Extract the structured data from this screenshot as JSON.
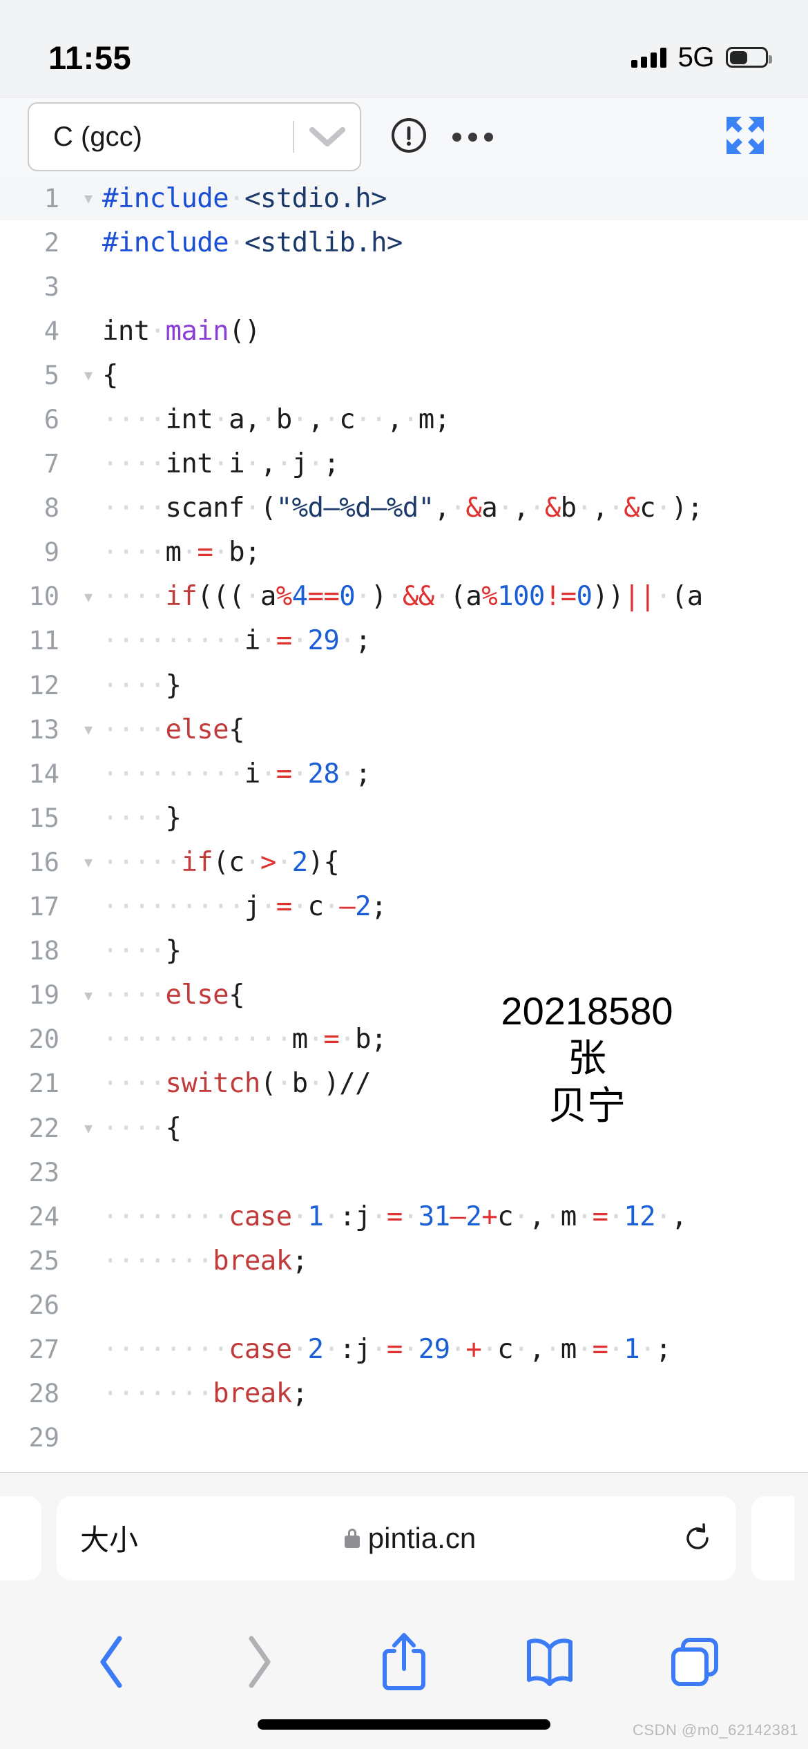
{
  "status_bar": {
    "time": "11:55",
    "network_label": "5G",
    "signal_icon": "signal-bars-icon",
    "battery_icon": "battery-icon",
    "battery_level_percent": 46
  },
  "editor_toolbar": {
    "language_value": "C (gcc)",
    "chevron_icon": "chevron-down-icon",
    "warning_icon": "exclamation-circle-icon",
    "more_icon": "ellipsis-icon",
    "expand_icon": "fullscreen-expand-icon",
    "accent_color": "#3b82f6"
  },
  "code": {
    "language": "C (gcc)",
    "lines": [
      {
        "n": "1",
        "fold": true,
        "highlight": true,
        "tokens": [
          {
            "t": "#include",
            "c": "t-pp"
          },
          {
            "t": "·",
            "c": "ws"
          },
          {
            "t": "<stdio.h>",
            "c": "t-hdr"
          }
        ]
      },
      {
        "n": "2",
        "fold": false,
        "highlight": false,
        "tokens": [
          {
            "t": "#include",
            "c": "t-pp"
          },
          {
            "t": "·",
            "c": "ws"
          },
          {
            "t": "<stdlib.h>",
            "c": "t-hdr"
          }
        ]
      },
      {
        "n": "3",
        "fold": false,
        "highlight": false,
        "tokens": []
      },
      {
        "n": "4",
        "fold": false,
        "highlight": false,
        "tokens": [
          {
            "t": "int",
            "c": "t-pun"
          },
          {
            "t": "·",
            "c": "ws"
          },
          {
            "t": "main",
            "c": "t-fn"
          },
          {
            "t": "()",
            "c": "t-pun"
          }
        ]
      },
      {
        "n": "5",
        "fold": true,
        "highlight": false,
        "tokens": [
          {
            "t": "{",
            "c": "t-pun"
          }
        ]
      },
      {
        "n": "6",
        "fold": false,
        "highlight": false,
        "tokens": [
          {
            "t": "····",
            "c": "ws"
          },
          {
            "t": "int",
            "c": "t-pun"
          },
          {
            "t": "·",
            "c": "ws"
          },
          {
            "t": "a,",
            "c": "t-pun"
          },
          {
            "t": "·",
            "c": "ws"
          },
          {
            "t": "b",
            "c": "t-pun"
          },
          {
            "t": "·",
            "c": "ws"
          },
          {
            "t": ",",
            "c": "t-pun"
          },
          {
            "t": "·",
            "c": "ws"
          },
          {
            "t": "c",
            "c": "t-pun"
          },
          {
            "t": "··",
            "c": "ws"
          },
          {
            "t": ",",
            "c": "t-pun"
          },
          {
            "t": "·",
            "c": "ws"
          },
          {
            "t": "m;",
            "c": "t-pun"
          }
        ]
      },
      {
        "n": "7",
        "fold": false,
        "highlight": false,
        "tokens": [
          {
            "t": "····",
            "c": "ws"
          },
          {
            "t": "int",
            "c": "t-pun"
          },
          {
            "t": "·",
            "c": "ws"
          },
          {
            "t": "i",
            "c": "t-pun"
          },
          {
            "t": "·",
            "c": "ws"
          },
          {
            "t": ",",
            "c": "t-pun"
          },
          {
            "t": "·",
            "c": "ws"
          },
          {
            "t": "j",
            "c": "t-pun"
          },
          {
            "t": "·",
            "c": "ws"
          },
          {
            "t": ";",
            "c": "t-pun"
          }
        ]
      },
      {
        "n": "8",
        "fold": false,
        "highlight": false,
        "tokens": [
          {
            "t": "····",
            "c": "ws"
          },
          {
            "t": "scanf",
            "c": "t-pun"
          },
          {
            "t": "·",
            "c": "ws"
          },
          {
            "t": "(",
            "c": "t-pun"
          },
          {
            "t": "\"%d–%d–%d\"",
            "c": "t-str"
          },
          {
            "t": ",",
            "c": "t-pun"
          },
          {
            "t": "·",
            "c": "ws"
          },
          {
            "t": "&",
            "c": "t-op"
          },
          {
            "t": "a",
            "c": "t-pun"
          },
          {
            "t": "·",
            "c": "ws"
          },
          {
            "t": ",",
            "c": "t-pun"
          },
          {
            "t": "·",
            "c": "ws"
          },
          {
            "t": "&",
            "c": "t-op"
          },
          {
            "t": "b",
            "c": "t-pun"
          },
          {
            "t": "·",
            "c": "ws"
          },
          {
            "t": ",",
            "c": "t-pun"
          },
          {
            "t": "·",
            "c": "ws"
          },
          {
            "t": "&",
            "c": "t-op"
          },
          {
            "t": "c",
            "c": "t-pun"
          },
          {
            "t": "·",
            "c": "ws"
          },
          {
            "t": ");",
            "c": "t-pun"
          }
        ]
      },
      {
        "n": "9",
        "fold": false,
        "highlight": false,
        "tokens": [
          {
            "t": "····",
            "c": "ws"
          },
          {
            "t": "m",
            "c": "t-pun"
          },
          {
            "t": "·",
            "c": "ws"
          },
          {
            "t": "=",
            "c": "t-op"
          },
          {
            "t": "·",
            "c": "ws"
          },
          {
            "t": "b;",
            "c": "t-pun"
          }
        ]
      },
      {
        "n": "10",
        "fold": true,
        "highlight": false,
        "tokens": [
          {
            "t": "····",
            "c": "ws"
          },
          {
            "t": "if",
            "c": "t-kw"
          },
          {
            "t": "(((",
            "c": "t-pun"
          },
          {
            "t": "·",
            "c": "ws"
          },
          {
            "t": "a",
            "c": "t-pun"
          },
          {
            "t": "%",
            "c": "t-op"
          },
          {
            "t": "4",
            "c": "t-num"
          },
          {
            "t": "==",
            "c": "t-op"
          },
          {
            "t": "0",
            "c": "t-num"
          },
          {
            "t": "·",
            "c": "ws"
          },
          {
            "t": ")",
            "c": "t-pun"
          },
          {
            "t": "·",
            "c": "ws"
          },
          {
            "t": "&&",
            "c": "t-op"
          },
          {
            "t": "·",
            "c": "ws"
          },
          {
            "t": "(a",
            "c": "t-pun"
          },
          {
            "t": "%",
            "c": "t-op"
          },
          {
            "t": "100",
            "c": "t-num"
          },
          {
            "t": "!=",
            "c": "t-op"
          },
          {
            "t": "0",
            "c": "t-num"
          },
          {
            "t": "))",
            "c": "t-pun"
          },
          {
            "t": "||",
            "c": "t-op"
          },
          {
            "t": "·",
            "c": "ws"
          },
          {
            "t": "(a",
            "c": "t-pun"
          }
        ]
      },
      {
        "n": "11",
        "fold": false,
        "highlight": false,
        "tokens": [
          {
            "t": "·········",
            "c": "ws"
          },
          {
            "t": "i",
            "c": "t-pun"
          },
          {
            "t": "·",
            "c": "ws"
          },
          {
            "t": "=",
            "c": "t-op"
          },
          {
            "t": "·",
            "c": "ws"
          },
          {
            "t": "29",
            "c": "t-num"
          },
          {
            "t": "·",
            "c": "ws"
          },
          {
            "t": ";",
            "c": "t-pun"
          }
        ]
      },
      {
        "n": "12",
        "fold": false,
        "highlight": false,
        "tokens": [
          {
            "t": "····",
            "c": "ws"
          },
          {
            "t": "}",
            "c": "t-pun"
          }
        ]
      },
      {
        "n": "13",
        "fold": true,
        "highlight": false,
        "tokens": [
          {
            "t": "····",
            "c": "ws"
          },
          {
            "t": "else",
            "c": "t-kw"
          },
          {
            "t": "{",
            "c": "t-pun"
          }
        ]
      },
      {
        "n": "14",
        "fold": false,
        "highlight": false,
        "tokens": [
          {
            "t": "·········",
            "c": "ws"
          },
          {
            "t": "i",
            "c": "t-pun"
          },
          {
            "t": "·",
            "c": "ws"
          },
          {
            "t": "=",
            "c": "t-op"
          },
          {
            "t": "·",
            "c": "ws"
          },
          {
            "t": "28",
            "c": "t-num"
          },
          {
            "t": "·",
            "c": "ws"
          },
          {
            "t": ";",
            "c": "t-pun"
          }
        ]
      },
      {
        "n": "15",
        "fold": false,
        "highlight": false,
        "tokens": [
          {
            "t": "····",
            "c": "ws"
          },
          {
            "t": "}",
            "c": "t-pun"
          }
        ]
      },
      {
        "n": "16",
        "fold": true,
        "highlight": false,
        "tokens": [
          {
            "t": "·····",
            "c": "ws"
          },
          {
            "t": "if",
            "c": "t-kw"
          },
          {
            "t": "(c",
            "c": "t-pun"
          },
          {
            "t": "·",
            "c": "ws"
          },
          {
            "t": ">",
            "c": "t-op"
          },
          {
            "t": "·",
            "c": "ws"
          },
          {
            "t": "2",
            "c": "t-num"
          },
          {
            "t": "){",
            "c": "t-pun"
          }
        ]
      },
      {
        "n": "17",
        "fold": false,
        "highlight": false,
        "tokens": [
          {
            "t": "·········",
            "c": "ws"
          },
          {
            "t": "j",
            "c": "t-pun"
          },
          {
            "t": "·",
            "c": "ws"
          },
          {
            "t": "=",
            "c": "t-op"
          },
          {
            "t": "·",
            "c": "ws"
          },
          {
            "t": "c",
            "c": "t-pun"
          },
          {
            "t": "·",
            "c": "ws"
          },
          {
            "t": "–",
            "c": "t-op"
          },
          {
            "t": "2",
            "c": "t-num"
          },
          {
            "t": ";",
            "c": "t-pun"
          }
        ]
      },
      {
        "n": "18",
        "fold": false,
        "highlight": false,
        "tokens": [
          {
            "t": "····",
            "c": "ws"
          },
          {
            "t": "}",
            "c": "t-pun"
          }
        ]
      },
      {
        "n": "19",
        "fold": true,
        "highlight": false,
        "tokens": [
          {
            "t": "····",
            "c": "ws"
          },
          {
            "t": "else",
            "c": "t-kw"
          },
          {
            "t": "{",
            "c": "t-pun"
          }
        ]
      },
      {
        "n": "20",
        "fold": false,
        "highlight": false,
        "tokens": [
          {
            "t": "············",
            "c": "ws"
          },
          {
            "t": "m",
            "c": "t-pun"
          },
          {
            "t": "·",
            "c": "ws"
          },
          {
            "t": "=",
            "c": "t-op"
          },
          {
            "t": "·",
            "c": "ws"
          },
          {
            "t": "b;",
            "c": "t-pun"
          }
        ]
      },
      {
        "n": "21",
        "fold": false,
        "highlight": false,
        "tokens": [
          {
            "t": "····",
            "c": "ws"
          },
          {
            "t": "switch",
            "c": "t-kw"
          },
          {
            "t": "(",
            "c": "t-pun"
          },
          {
            "t": "·",
            "c": "ws"
          },
          {
            "t": "b",
            "c": "t-pun"
          },
          {
            "t": "·",
            "c": "ws"
          },
          {
            "t": ")//",
            "c": "t-pun"
          }
        ]
      },
      {
        "n": "22",
        "fold": true,
        "highlight": false,
        "tokens": [
          {
            "t": "····",
            "c": "ws"
          },
          {
            "t": "{",
            "c": "t-pun"
          }
        ]
      },
      {
        "n": "23",
        "fold": false,
        "highlight": false,
        "tokens": []
      },
      {
        "n": "24",
        "fold": false,
        "highlight": false,
        "tokens": [
          {
            "t": "········",
            "c": "ws"
          },
          {
            "t": "case",
            "c": "t-kw"
          },
          {
            "t": "·",
            "c": "ws"
          },
          {
            "t": "1",
            "c": "t-num"
          },
          {
            "t": "·",
            "c": "ws"
          },
          {
            "t": ":j",
            "c": "t-pun"
          },
          {
            "t": "·",
            "c": "ws"
          },
          {
            "t": "=",
            "c": "t-op"
          },
          {
            "t": "·",
            "c": "ws"
          },
          {
            "t": "31",
            "c": "t-num"
          },
          {
            "t": "–",
            "c": "t-op"
          },
          {
            "t": "2",
            "c": "t-num"
          },
          {
            "t": "+",
            "c": "t-op"
          },
          {
            "t": "c",
            "c": "t-pun"
          },
          {
            "t": "·",
            "c": "ws"
          },
          {
            "t": ",",
            "c": "t-pun"
          },
          {
            "t": "·",
            "c": "ws"
          },
          {
            "t": "m",
            "c": "t-pun"
          },
          {
            "t": "·",
            "c": "ws"
          },
          {
            "t": "=",
            "c": "t-op"
          },
          {
            "t": "·",
            "c": "ws"
          },
          {
            "t": "12",
            "c": "t-num"
          },
          {
            "t": "·",
            "c": "ws"
          },
          {
            "t": ",",
            "c": "t-pun"
          }
        ]
      },
      {
        "n": "25",
        "fold": false,
        "highlight": false,
        "tokens": [
          {
            "t": "·······",
            "c": "ws"
          },
          {
            "t": "break",
            "c": "t-kw"
          },
          {
            "t": ";",
            "c": "t-pun"
          }
        ]
      },
      {
        "n": "26",
        "fold": false,
        "highlight": false,
        "tokens": []
      },
      {
        "n": "27",
        "fold": false,
        "highlight": false,
        "tokens": [
          {
            "t": "········",
            "c": "ws"
          },
          {
            "t": "case",
            "c": "t-kw"
          },
          {
            "t": "·",
            "c": "ws"
          },
          {
            "t": "2",
            "c": "t-num"
          },
          {
            "t": "·",
            "c": "ws"
          },
          {
            "t": ":j",
            "c": "t-pun"
          },
          {
            "t": "·",
            "c": "ws"
          },
          {
            "t": "=",
            "c": "t-op"
          },
          {
            "t": "·",
            "c": "ws"
          },
          {
            "t": "29",
            "c": "t-num"
          },
          {
            "t": "·",
            "c": "ws"
          },
          {
            "t": "+",
            "c": "t-op"
          },
          {
            "t": "·",
            "c": "ws"
          },
          {
            "t": "c",
            "c": "t-pun"
          },
          {
            "t": "·",
            "c": "ws"
          },
          {
            "t": ",",
            "c": "t-pun"
          },
          {
            "t": "·",
            "c": "ws"
          },
          {
            "t": "m",
            "c": "t-pun"
          },
          {
            "t": "·",
            "c": "ws"
          },
          {
            "t": "=",
            "c": "t-op"
          },
          {
            "t": "·",
            "c": "ws"
          },
          {
            "t": "1",
            "c": "t-num"
          },
          {
            "t": "·",
            "c": "ws"
          },
          {
            "t": ";",
            "c": "t-pun"
          }
        ]
      },
      {
        "n": "28",
        "fold": false,
        "highlight": false,
        "tokens": [
          {
            "t": "·······",
            "c": "ws"
          },
          {
            "t": "break",
            "c": "t-kw"
          },
          {
            "t": ";",
            "c": "t-pun"
          }
        ]
      },
      {
        "n": "29",
        "fold": false,
        "highlight": false,
        "tokens": []
      }
    ]
  },
  "watermark": {
    "line1": "20218580张",
    "line2": "贝宁"
  },
  "safari": {
    "text_size_label": "大小",
    "lock_icon": "lock-icon",
    "url": "pintia.cn",
    "reload_icon": "reload-icon",
    "back_icon": "chevron-left-icon",
    "forward_icon": "chevron-right-icon",
    "share_icon": "share-icon",
    "bookmarks_icon": "book-icon",
    "tabs_icon": "tabs-icon",
    "accent_color": "#3b7bf6",
    "disabled_color": "#b0b0b5"
  },
  "footer_watermark": "CSDN @m0_62142381"
}
